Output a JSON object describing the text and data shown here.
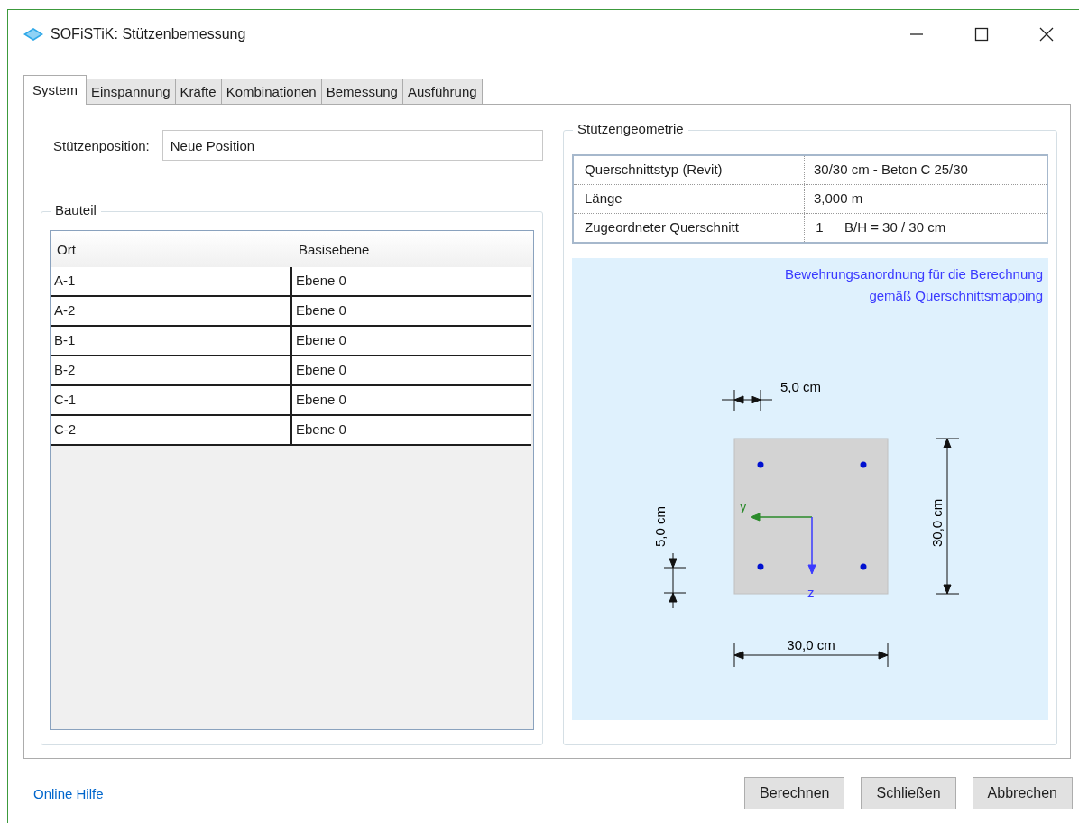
{
  "window": {
    "title": "SOFiSTiK: Stützenbemessung"
  },
  "tabs": [
    {
      "label": "System",
      "selected": true
    },
    {
      "label": "Einspannung",
      "selected": false
    },
    {
      "label": "Kräfte",
      "selected": false
    },
    {
      "label": "Kombinationen",
      "selected": false
    },
    {
      "label": "Bemessung",
      "selected": false
    },
    {
      "label": "Ausführung",
      "selected": false
    }
  ],
  "position_field": {
    "label": "Stützenposition:",
    "value": "Neue Position"
  },
  "bauteil": {
    "title": "Bauteil",
    "columns": [
      "Ort",
      "Basisebene"
    ],
    "rows": [
      [
        "A-1",
        "Ebene 0"
      ],
      [
        "A-2",
        "Ebene 0"
      ],
      [
        "B-1",
        "Ebene 0"
      ],
      [
        "B-2",
        "Ebene 0"
      ],
      [
        "C-1",
        "Ebene 0"
      ],
      [
        "C-2",
        "Ebene 0"
      ]
    ]
  },
  "geometry": {
    "title": "Stützengeometrie",
    "rows": [
      {
        "label": "Querschnittstyp (Revit)",
        "values": [
          "30/30 cm - Beton C 25/30"
        ]
      },
      {
        "label": "Länge",
        "values": [
          "3,000 m"
        ]
      },
      {
        "label": "Zugeordneter Querschnitt",
        "values": [
          "1",
          "B/H = 30 / 30 cm"
        ]
      }
    ],
    "diagram": {
      "caption": [
        "Bewehrungsanordnung für die Berechnung",
        "gemäß Querschnittsmapping"
      ],
      "cover_top": "5,0 cm",
      "cover_left": "5,0 cm",
      "height": "30,0 cm",
      "width": "30,0 cm",
      "axis_y": "y",
      "axis_z": "z"
    }
  },
  "footer": {
    "link": "Online Hilfe",
    "buttons": [
      "Berechnen",
      "Schließen",
      "Abbrechen"
    ]
  }
}
